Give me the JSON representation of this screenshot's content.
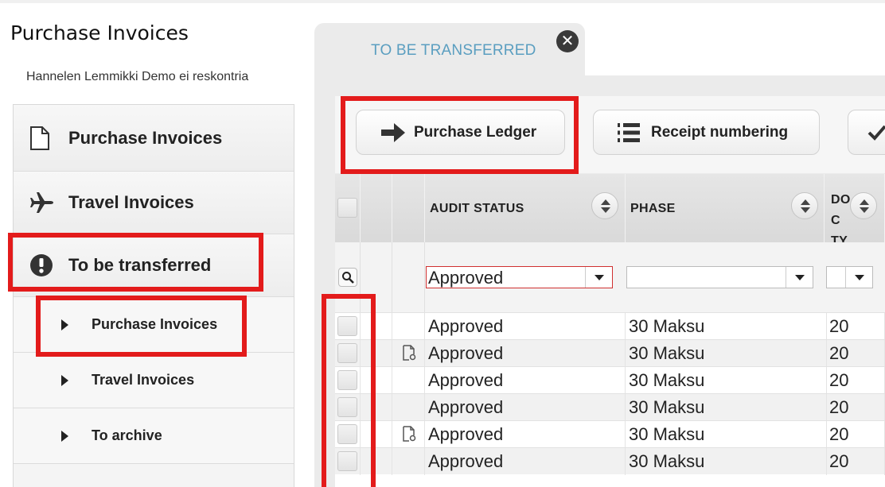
{
  "app": {
    "title": "Purchase Invoices",
    "company": "Hannelen Lemmikki Demo ei reskontria"
  },
  "sidebar": {
    "items": [
      {
        "label": "Purchase Invoices",
        "icon": "document-icon"
      },
      {
        "label": "Travel Invoices",
        "icon": "airplane-icon"
      },
      {
        "label": "To be transferred",
        "icon": "exclamation-icon"
      }
    ],
    "sub_items": [
      {
        "label": "Purchase Invoices"
      },
      {
        "label": "Travel Invoices"
      },
      {
        "label": "To archive"
      }
    ]
  },
  "tab": {
    "label": "TO BE TRANSFERRED",
    "close_symbol": "✕"
  },
  "toolbar": {
    "purchase_ledger": "Purchase Ledger",
    "receipt_numbering": "Receipt numbering"
  },
  "grid": {
    "columns": [
      "AUDIT STATUS",
      "PHASE",
      "DOC TY"
    ],
    "filters": {
      "audit_status": "Approved",
      "phase": "",
      "doc_type": ""
    },
    "rows": [
      {
        "attachment": false,
        "audit_status": "Approved",
        "phase": "30 Maksu",
        "doc_type": "20"
      },
      {
        "attachment": true,
        "audit_status": "Approved",
        "phase": "30 Maksu",
        "doc_type": "20"
      },
      {
        "attachment": false,
        "audit_status": "Approved",
        "phase": "30 Maksu",
        "doc_type": "20"
      },
      {
        "attachment": false,
        "audit_status": "Approved",
        "phase": "30 Maksu",
        "doc_type": "20"
      },
      {
        "attachment": true,
        "audit_status": "Approved",
        "phase": "30 Maksu",
        "doc_type": "20"
      },
      {
        "attachment": false,
        "audit_status": "Approved",
        "phase": "30 Maksu",
        "doc_type": "20"
      }
    ]
  },
  "colors": {
    "highlight": "#e31b1b",
    "tab_text": "#5a9ec0"
  }
}
